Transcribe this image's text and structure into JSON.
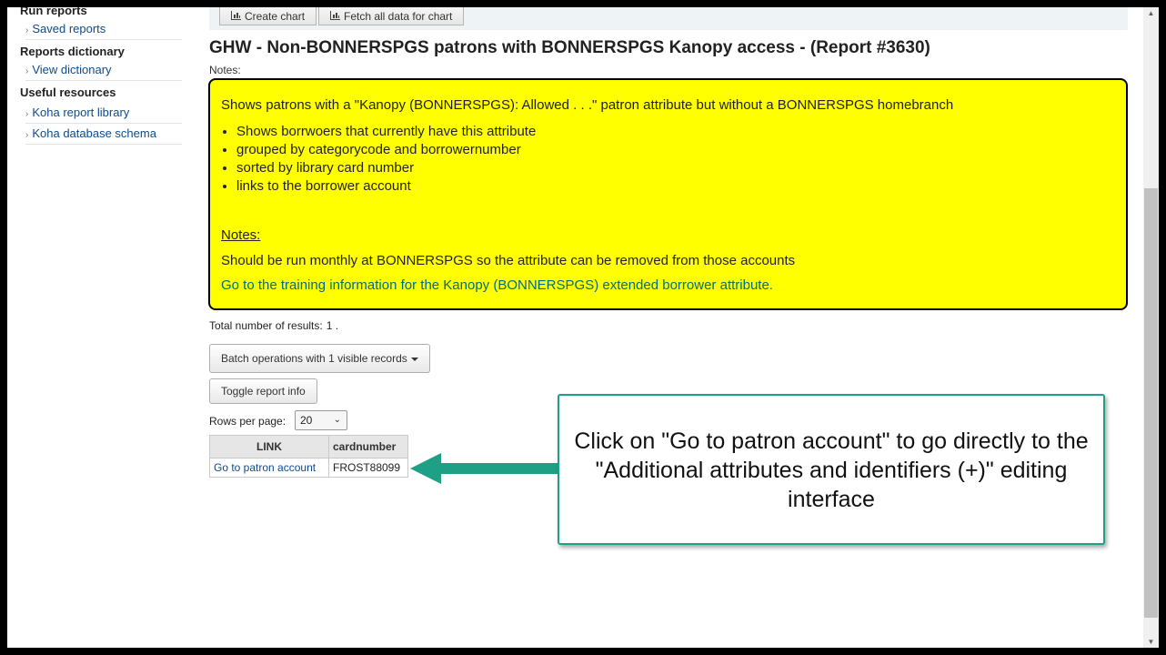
{
  "sidebar": {
    "sections": [
      {
        "heading": "Run reports",
        "items": [
          "Saved reports"
        ]
      },
      {
        "heading": "Reports dictionary",
        "items": [
          "View dictionary"
        ]
      },
      {
        "heading": "Useful resources",
        "items": [
          "Koha report library",
          "Koha database schema"
        ]
      }
    ],
    "chevron": "›"
  },
  "toolbar": {
    "create_chart": "Create chart",
    "fetch_all": "Fetch all data for chart",
    "chart_icon": "bar-chart-icon"
  },
  "report": {
    "title": "GHW - Non-BONNERSPGS patrons with BONNERSPGS Kanopy access - (Report #3630)",
    "notes_label": "Notes:",
    "description": "Shows patrons with a \"Kanopy (BONNERSPGS): Allowed . . .\" patron attribute but without a BONNERSPGS homebranch",
    "bullets": [
      "Shows borrwoers that currently have this attribute",
      "grouped by categorycode and borrowernumber",
      "sorted by library card number",
      "links to the borrower account"
    ],
    "notes_heading": "Notes:",
    "note_line": "Should be run monthly at BONNERSPGS so the attribute can be removed from those accounts",
    "training_link": "Go to the training information for the Kanopy (BONNERSPGS) extended borrower attribute.",
    "highlight_color": "#ffff00"
  },
  "results": {
    "label": "Total number of results:",
    "count": "1 ."
  },
  "buttons": {
    "batch": "Batch operations with 1 visible records",
    "toggle": "Toggle report info"
  },
  "pagination": {
    "rows_label": "Rows per page:",
    "rows_value": "20"
  },
  "table": {
    "headers": [
      "LINK",
      "cardnumber"
    ],
    "rows": [
      [
        "Go to patron account",
        "FROST88099"
      ]
    ]
  },
  "callout": {
    "text": "Click on \"Go to patron account\" to go directly to the \"Additional attributes and identifiers (+)\" editing interface",
    "accent": "#1ea087"
  }
}
